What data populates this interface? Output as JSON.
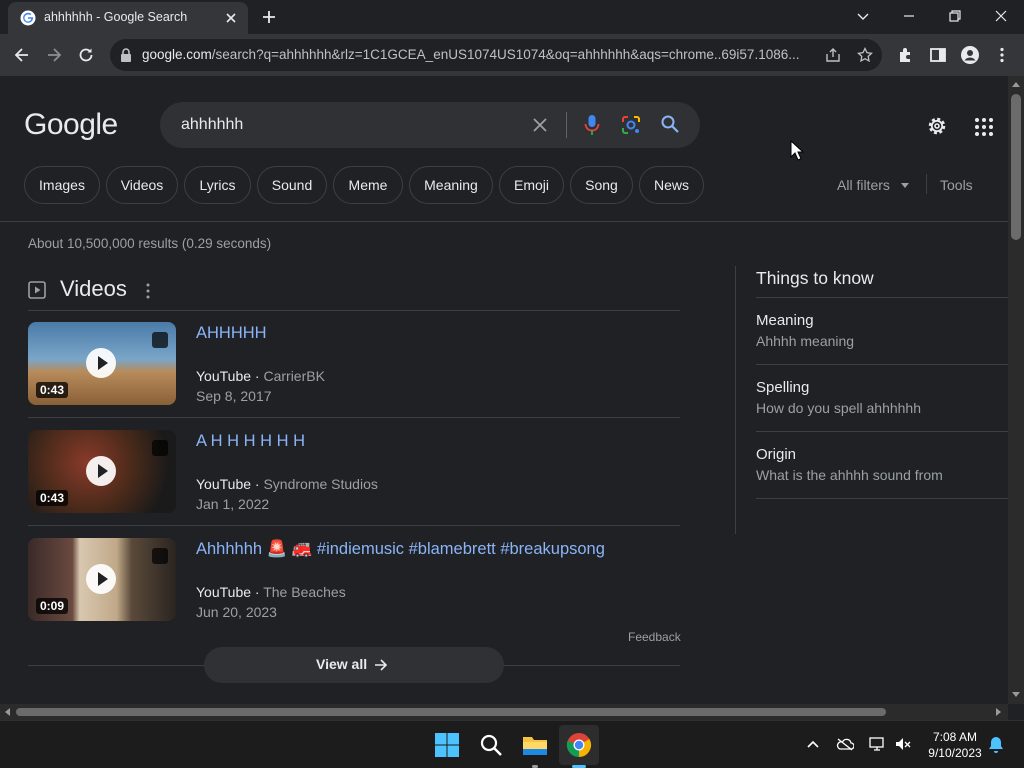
{
  "browser": {
    "tab_title": "ahhhhhh - Google Search",
    "url_host": "google.com",
    "url_rest": "/search?q=ahhhhhh&rlz=1C1GCEA_enUS1074US1074&oq=ahhhhhh&aqs=chrome..69i57.1086..."
  },
  "search": {
    "logo": "Google",
    "query": "ahhhhhh"
  },
  "chips": [
    "Images",
    "Videos",
    "Lyrics",
    "Sound",
    "Meme",
    "Meaning",
    "Emoji",
    "Song",
    "News"
  ],
  "filters": {
    "all_filters": "All filters",
    "tools": "Tools"
  },
  "stats": "About 10,500,000 results (0.29 seconds)",
  "videos": {
    "heading": "Videos",
    "items": [
      {
        "title": "AHHHHH",
        "platform": "YouTube",
        "channel": "CarrierBK",
        "date": "Sep 8, 2017",
        "duration": "0:43"
      },
      {
        "title": "A H H H H H H",
        "platform": "YouTube",
        "channel": "Syndrome Studios",
        "date": "Jan 1, 2022",
        "duration": "0:43"
      },
      {
        "title": "Ahhhhhh 🚨 🚒 #indiemusic #blamebrett #breakupsong",
        "platform": "YouTube",
        "channel": "The Beaches",
        "date": "Jun 20, 2023",
        "duration": "0:09"
      }
    ],
    "feedback": "Feedback",
    "view_all": "View all"
  },
  "things_to_know": {
    "heading": "Things to know",
    "items": [
      {
        "title": "Meaning",
        "subtitle": "Ahhhh meaning"
      },
      {
        "title": "Spelling",
        "subtitle": "How do you spell ahhhhhh"
      },
      {
        "title": "Origin",
        "subtitle": "What is the ahhhh sound from"
      }
    ]
  },
  "taskbar": {
    "time": "7:08 AM",
    "date": "9/10/2023"
  },
  "colors": {
    "background": "#202124",
    "link": "#8ab4f8",
    "surface": "#303134",
    "taskbar": "#1c1c1c"
  },
  "icons": [
    "google-favicon",
    "close-icon",
    "plus-icon",
    "minimize-icon",
    "maximize-icon",
    "back-icon",
    "forward-icon",
    "reload-icon",
    "lock-icon",
    "share-icon",
    "star-icon",
    "extensions-icon",
    "sidepanel-icon",
    "profile-icon",
    "menu-icon",
    "mic-icon",
    "lens-icon",
    "search-icon",
    "gear-icon",
    "apps-icon",
    "play-icon",
    "expand-icon",
    "arrow-right-icon",
    "windows-start-icon",
    "file-explorer-icon",
    "chrome-icon",
    "bell-icon"
  ]
}
